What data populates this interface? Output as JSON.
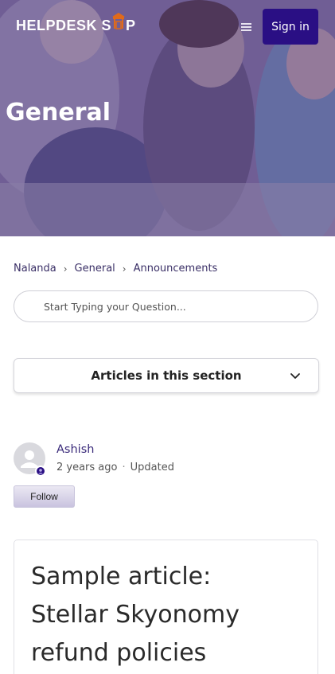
{
  "header": {
    "brand": "HELPDESK SHOP",
    "brand_prefix": "HELPDESK S",
    "brand_suffix": "P",
    "menu_icon": "hamburger-icon",
    "signin_label": "Sign in"
  },
  "hero": {
    "title": "General"
  },
  "breadcrumb": {
    "items": [
      "Nalanda",
      "General",
      "Announcements"
    ]
  },
  "search": {
    "placeholder": "Start Typing your Question..."
  },
  "articles_section": {
    "label": "Articles in this section",
    "icon": "chevron-down-icon"
  },
  "author": {
    "name": "Ashish",
    "time": "2 years ago",
    "status": "Updated",
    "follow_label": "Follow",
    "avatar_icon": "user-icon"
  },
  "article": {
    "title": "Sample article: Stellar Skyonomy refund policies"
  },
  "colors": {
    "brand_primary": "#2a0f84",
    "logo_accent": "#e06a1b",
    "link_text": "#3a2a7a"
  }
}
